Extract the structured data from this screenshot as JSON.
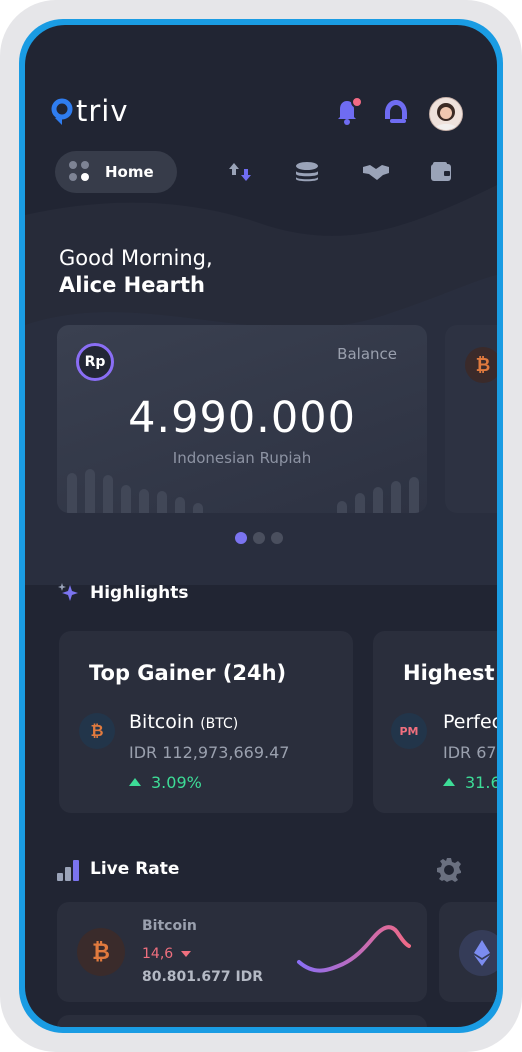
{
  "app": {
    "logo_text": "triv"
  },
  "nav": {
    "home_label": "Home"
  },
  "greeting": {
    "line1": "Good Morning,",
    "name": "Alice Hearth"
  },
  "balance": {
    "badge": "Rp",
    "label": "Balance",
    "amount": "4.990.000",
    "currency": "Indonesian Rupiah"
  },
  "peek_card": {
    "badge": "₿"
  },
  "highlights": {
    "title": "Highlights",
    "cards": [
      {
        "title": "Top Gainer (24h)",
        "coin_glyph": "₿",
        "coin_name": "Bitcoin",
        "coin_symbol": "(BTC)",
        "price": "IDR 112,973,669.47",
        "change": "3.09%"
      },
      {
        "title": "Highest",
        "coin_glyph": "PM",
        "coin_name": "Perfec",
        "coin_symbol": "",
        "price": "IDR 67,",
        "change": "31.6"
      }
    ]
  },
  "live_rate": {
    "title": "Live Rate",
    "items": [
      {
        "coin_glyph": "₿",
        "name": "Bitcoin",
        "change": "14,6",
        "price": "80.801.677 IDR"
      }
    ]
  },
  "colors": {
    "accent": "#7b74f0",
    "positive": "#3ddc97",
    "negative": "#ef6f7e",
    "btc": "#e07a3e"
  }
}
